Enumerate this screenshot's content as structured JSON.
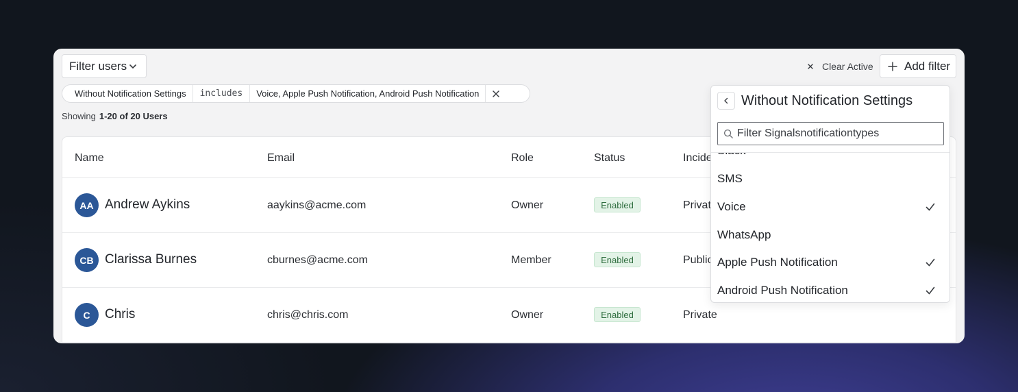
{
  "toolbar": {
    "filter_users_label": "Filter users",
    "clear_active_label": "Clear Active",
    "add_filter_label": "Add filter"
  },
  "active_filter": {
    "field": "Without Notification Settings",
    "operator": "includes",
    "value": "Voice, Apple Push Notification, Android Push Notification"
  },
  "summary": {
    "showing_label": "Showing",
    "range": "1-20 of 20 Users"
  },
  "table": {
    "columns": [
      "Name",
      "Email",
      "Role",
      "Status",
      "Incide"
    ],
    "rows": [
      {
        "initials": "AA",
        "name": "Andrew Aykins",
        "email": "aaykins@acme.com",
        "role": "Owner",
        "status": "Enabled",
        "incident": "Privat"
      },
      {
        "initials": "CB",
        "name": "Clarissa Burnes",
        "email": "cburnes@acme.com",
        "role": "Member",
        "status": "Enabled",
        "incident": "Public"
      },
      {
        "initials": "C",
        "name": "Chris",
        "email": "chris@chris.com",
        "role": "Owner",
        "status": "Enabled",
        "incident": "Private"
      }
    ]
  },
  "popover": {
    "title": "Without Notification Settings",
    "search_placeholder": "Filter Signalsnotificationtypes",
    "options": [
      {
        "label": "Slack",
        "checked": false
      },
      {
        "label": "SMS",
        "checked": false
      },
      {
        "label": "Voice",
        "checked": true
      },
      {
        "label": "WhatsApp",
        "checked": false
      },
      {
        "label": "Apple Push Notification",
        "checked": true
      },
      {
        "label": "Android Push Notification",
        "checked": true
      }
    ]
  },
  "colors": {
    "avatar": "#2b5797",
    "enabled_badge_bg": "#e3f3e7",
    "enabled_badge_text": "#2d6c3d"
  }
}
